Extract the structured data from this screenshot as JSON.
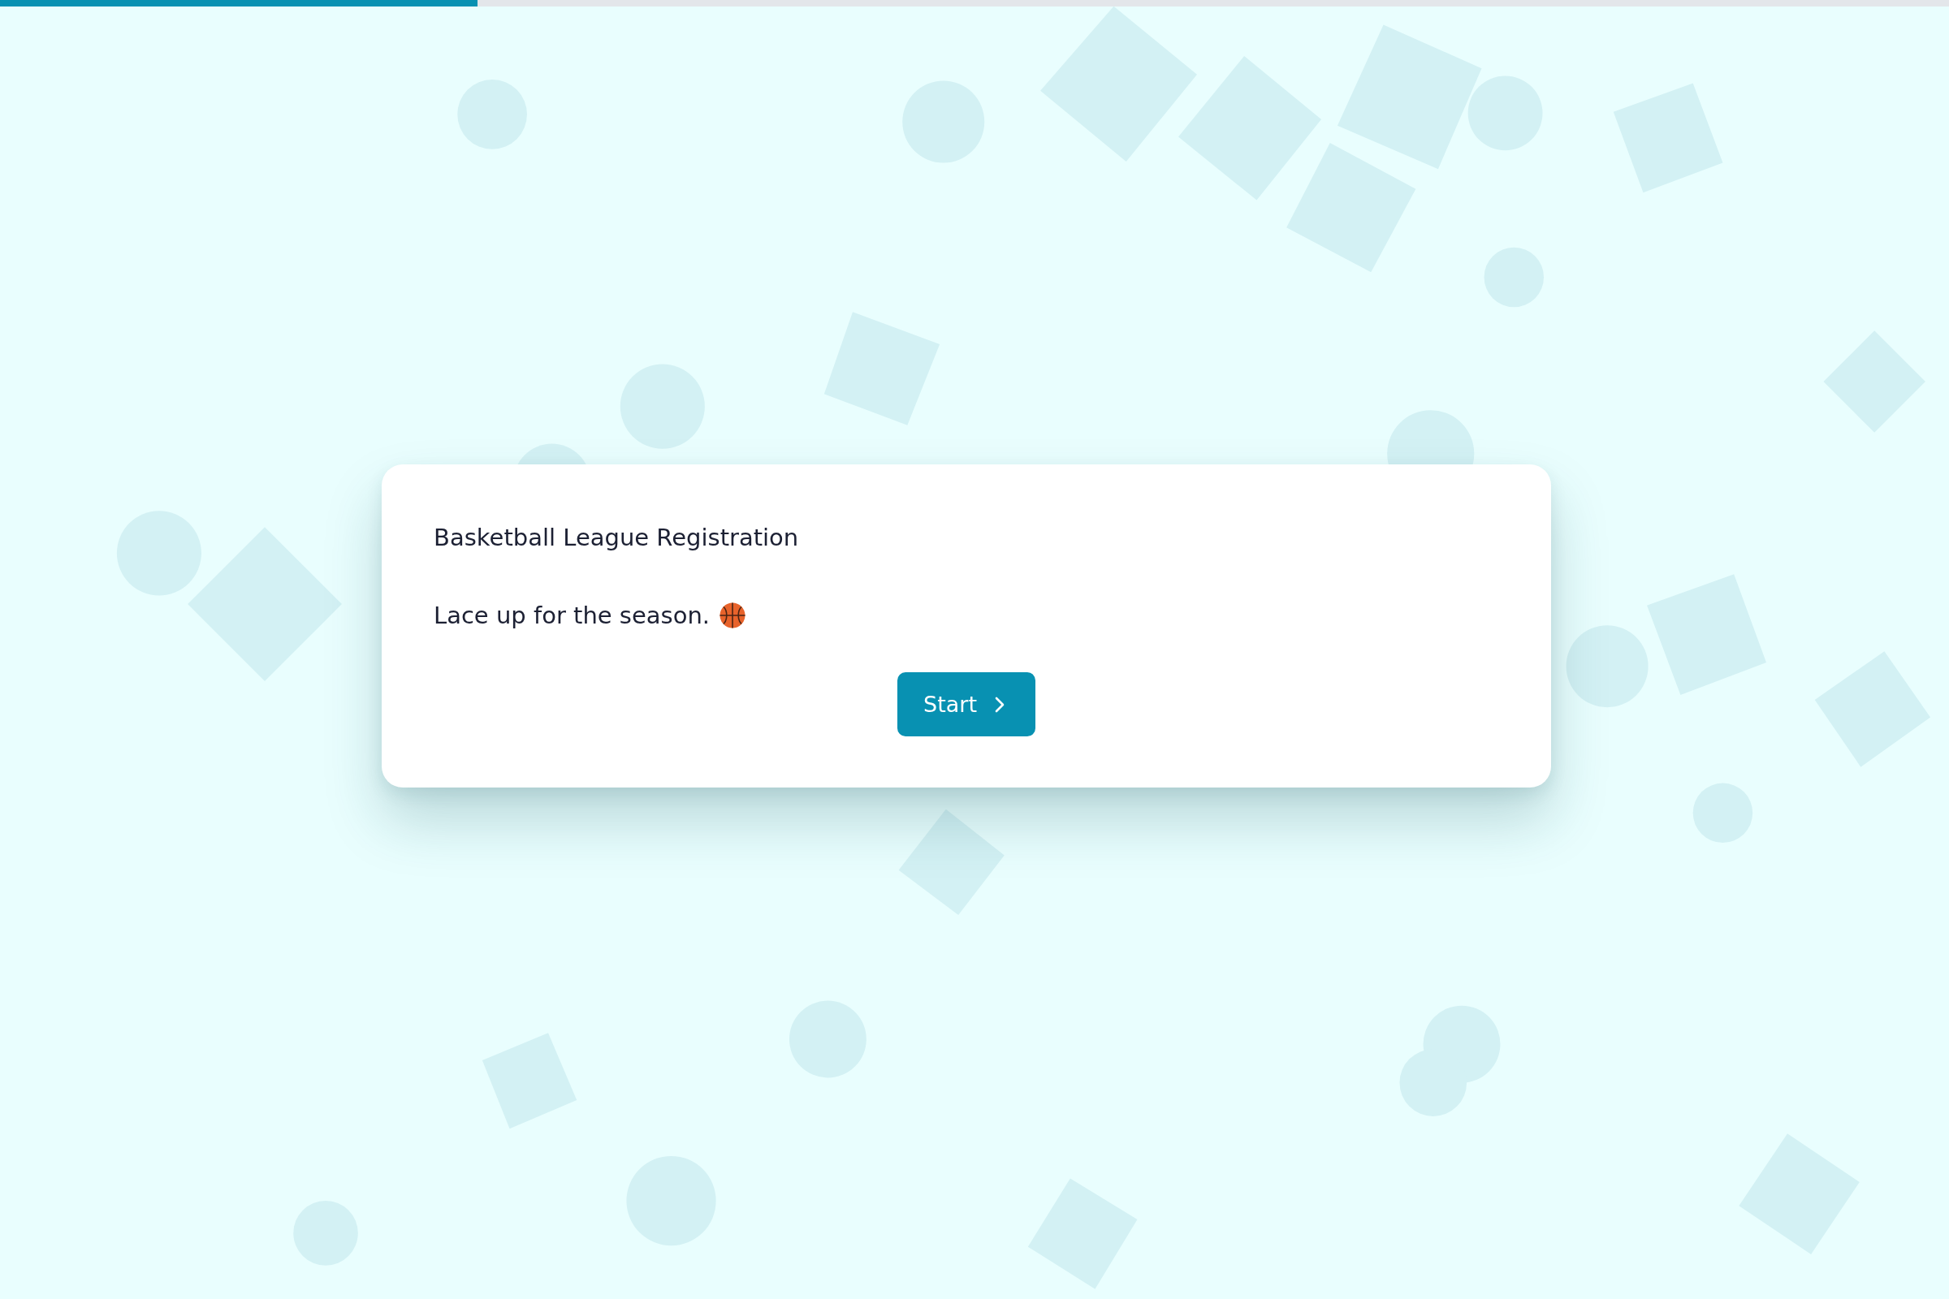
{
  "progress": {
    "level": 0.245
  },
  "card": {
    "title": "Basketball League Registration",
    "subtitle": "Lace up for the season.",
    "button": {
      "label": "Start"
    }
  }
}
